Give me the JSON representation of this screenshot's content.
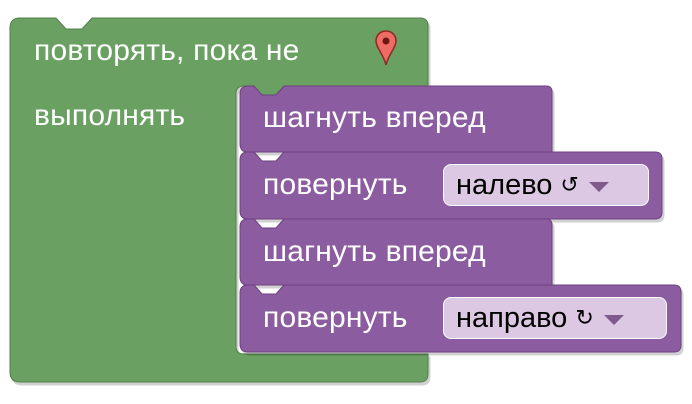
{
  "colors": {
    "loop_block": "#6ba162",
    "loop_block_border": "#52804a",
    "action_block": "#8c5ba0",
    "action_block_border": "#6e4080",
    "dropdown_bg": "#ddc8e3",
    "dropdown_arrow": "#7e5a8d",
    "marker": "#ef6b65"
  },
  "loop": {
    "header_label": "повторять, пока не",
    "do_label": "выполнять",
    "condition_icon": "map-marker-icon"
  },
  "actions": [
    {
      "label": "шагнуть вперед"
    },
    {
      "label": "повернуть",
      "dropdown": {
        "value": "налево",
        "rotation_symbol": "↺",
        "rotation_icon": "rotate-left-icon"
      }
    },
    {
      "label": "шагнуть вперед"
    },
    {
      "label": "повернуть",
      "dropdown": {
        "value": "направо",
        "rotation_symbol": "↻",
        "rotation_icon": "rotate-right-icon"
      }
    }
  ]
}
